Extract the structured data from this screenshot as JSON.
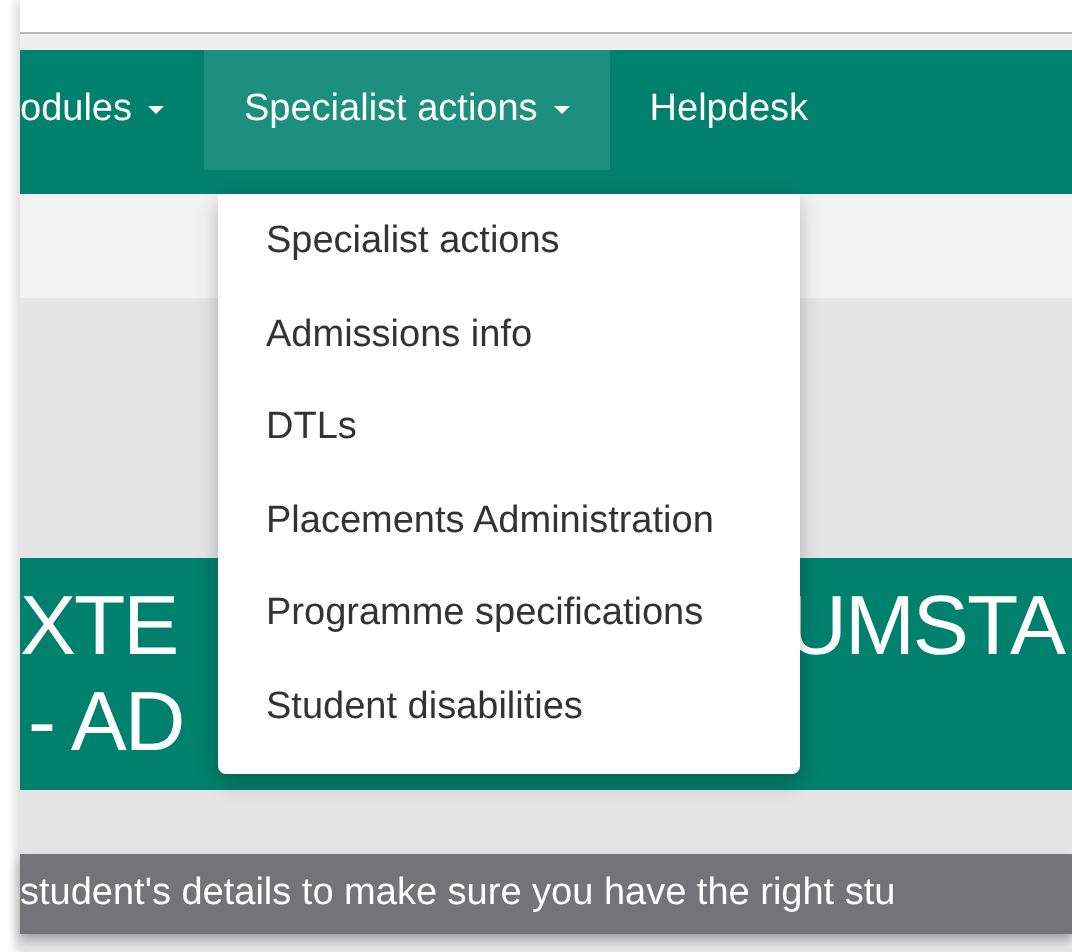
{
  "navbar": {
    "items": [
      {
        "label": "odules",
        "has_caret": true,
        "selected": false
      },
      {
        "label": "Specialist actions",
        "has_caret": true,
        "selected": true
      },
      {
        "label": "Helpdesk",
        "has_caret": false,
        "selected": false
      }
    ]
  },
  "dropdown": {
    "items": [
      {
        "label": "Specialist actions"
      },
      {
        "label": "Admissions info"
      },
      {
        "label": "DTLs"
      },
      {
        "label": "Placements Administration"
      },
      {
        "label": "Programme specifications"
      },
      {
        "label": "Student disabilities"
      }
    ]
  },
  "banner": {
    "line_1": [
      "XTE",
      "UMSTA"
    ],
    "line_2": "- AD"
  },
  "notice": "student's details to make sure you have the right stu"
}
